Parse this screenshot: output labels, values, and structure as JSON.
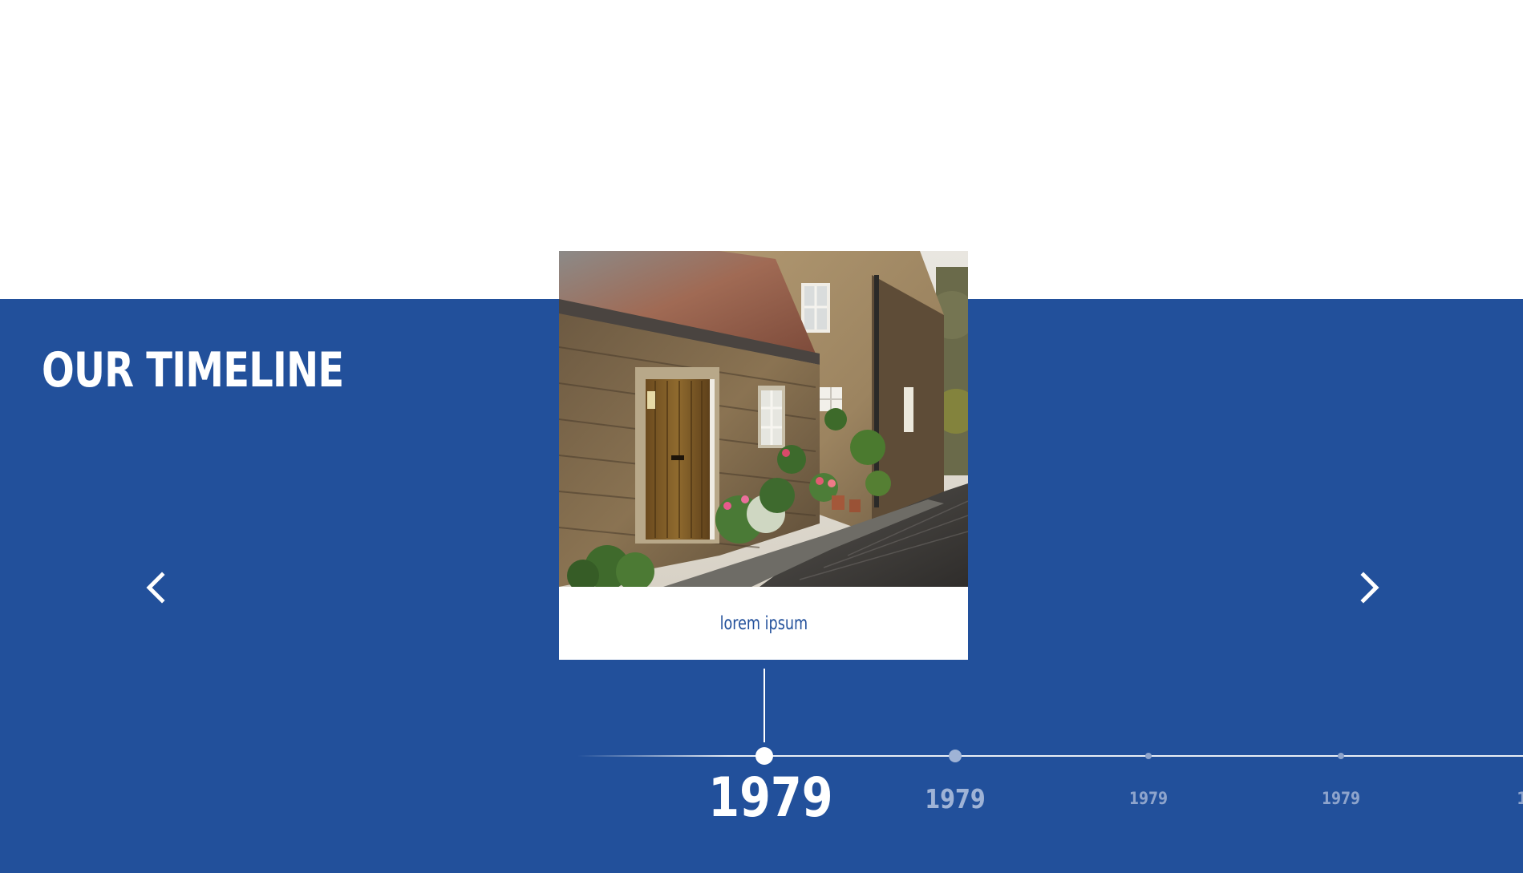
{
  "section": {
    "title": "OUR TIMELINE"
  },
  "colors": {
    "band": "#22509b",
    "text_light": "#ffffff",
    "year_muted": "#9fb3d6",
    "year_faint": "#8ea4cc"
  },
  "navigation": {
    "prev_icon": "chevron-left-icon",
    "next_icon": "chevron-right-icon"
  },
  "card": {
    "image_subject": "stone-cottage-photo",
    "caption": "lorem ipsum"
  },
  "timeline": {
    "items": [
      {
        "year": "1979",
        "state": "active"
      },
      {
        "year": "1979",
        "state": "next"
      },
      {
        "year": "1979",
        "state": "far"
      },
      {
        "year": "1979",
        "state": "far"
      },
      {
        "year": "1",
        "state": "clipped"
      }
    ]
  }
}
